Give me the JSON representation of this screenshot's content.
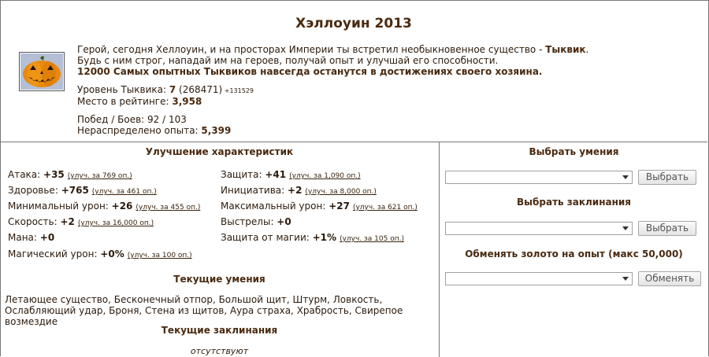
{
  "header": {
    "title": "Хэллоуин 2013",
    "intro_line1_prefix": "Герой, сегодня Хеллоуин, и на просторах Империи ты встретил необыкновенное существо - ",
    "intro_creature": "Тыквик",
    "intro_line1_suffix": ".",
    "intro_line2": "Будь с ним строг, нападай им на героев, получай опыт и улучшай его способности.",
    "intro_line3": "12000 Самых опытных Тыквиков навсегда останутся в достижениях своего хозяина."
  },
  "stats": {
    "level_label": "Уровень Тыквика: ",
    "level_value": "7",
    "level_exp": " (268471)",
    "level_next": " +131529",
    "rank_label": "Место в рейтинге: ",
    "rank_value": "3,958",
    "wins_label": "Побед / Боев: 92 / 103",
    "free_exp_label": "Нераспределено опыта: ",
    "free_exp_value": "5,399"
  },
  "left": {
    "upgrade_title": "Улучшение характеристик",
    "attributes_left": [
      {
        "label": "Атака: ",
        "value": "+35",
        "upgrade": "(улуч. за 769 оп.)"
      },
      {
        "label": "Здоровье: ",
        "value": "+765",
        "upgrade": "(улуч. за 461 оп.)"
      },
      {
        "label": "Минимальный урон: ",
        "value": "+26",
        "upgrade": "(улуч. за 455 оп.)"
      },
      {
        "label": "Скорость: ",
        "value": "+2",
        "upgrade": "(улуч. за 16,000 оп.)"
      },
      {
        "label": "Мана: ",
        "value": "+0",
        "upgrade": ""
      },
      {
        "label": "Магический урон: ",
        "value": "+0%",
        "upgrade": "(улуч. за 100 оп.)"
      }
    ],
    "attributes_right": [
      {
        "label": "Защита: ",
        "value": "+41",
        "upgrade": "(улуч. за 1,090 оп.)"
      },
      {
        "label": "Инициатива: ",
        "value": "+2",
        "upgrade": "(улуч. за 8,000 оп.)"
      },
      {
        "label": "Максимальный урон: ",
        "value": "+27",
        "upgrade": "(улуч. за 621 оп.)"
      },
      {
        "label": "Выстрелы: ",
        "value": "+0",
        "upgrade": ""
      },
      {
        "label": "Защита от магии: ",
        "value": "+1%",
        "upgrade": "(улуч. за 105 оп.)"
      }
    ],
    "skills_title": "Текущие умения",
    "skills_text": "Летающее существо, Бесконечный отпор, Большой щит, Штурм, Ловкость, Ослабляющий удар, Броня, Стена из щитов, Аура страха, Храбрость, Свирепое возмездие",
    "spells_title": "Текущие заклинания",
    "spells_text": "отсутствуют"
  },
  "right": {
    "choose_skills_title": "Выбрать умения",
    "choose_skills_button": "Выбрать",
    "choose_spells_title": "Выбрать заклинания",
    "choose_spells_button": "Выбрать",
    "exchange_title": "Обменять золото на опыт (макс 50,000)",
    "exchange_button": "Обменять"
  },
  "colors": {
    "text": "#2c1a0c",
    "heading": "#4a2a10",
    "border": "#777777"
  }
}
